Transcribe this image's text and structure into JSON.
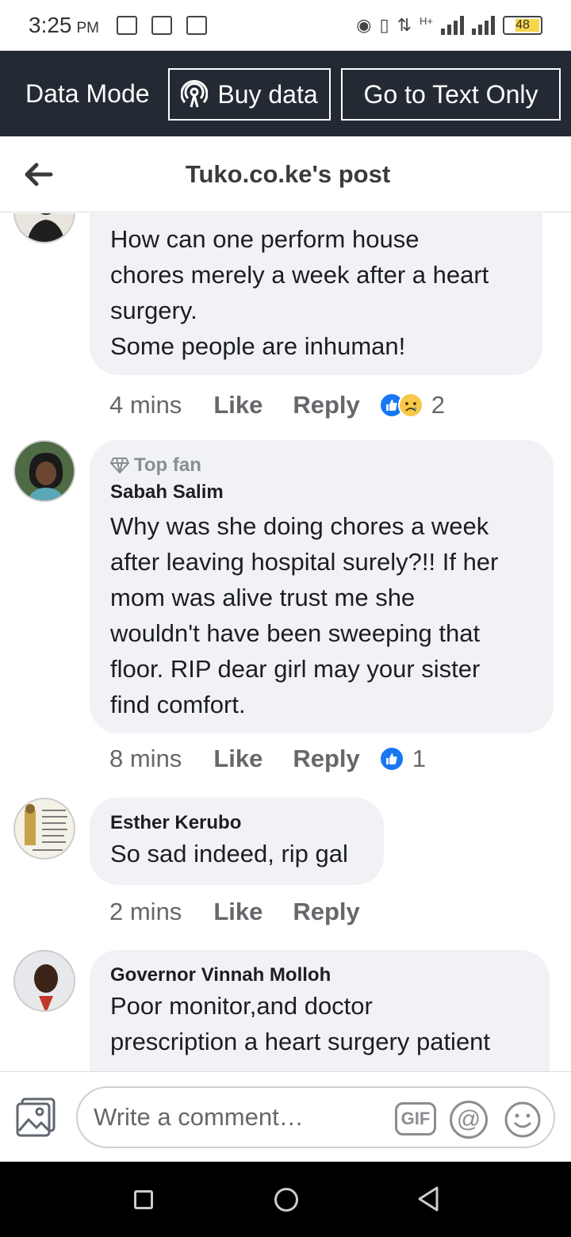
{
  "status_bar": {
    "time": "3:25",
    "ampm": "PM",
    "battery": "48",
    "network": "H+"
  },
  "data_bar": {
    "mode_label": "Data Mode",
    "buy_label": "Buy data",
    "text_only_label": "Go to Text Only"
  },
  "header": {
    "title": "Tuko.co.ke's post"
  },
  "comments": [
    {
      "text": "How can one perform house\nchores merely a week after a heart\nsurgery.\nSome people are inhuman!",
      "time": "4 mins",
      "like": "Like",
      "reply": "Reply",
      "reaction_count": "2"
    },
    {
      "badge": "Top fan",
      "author": "Sabah Salim",
      "text": "Why was she doing chores a week\nafter leaving hospital surely?!! If her\nmom was alive trust me she\nwouldn't have been sweeping that\nfloor. RIP dear girl may your sister\nfind comfort.",
      "time": "8 mins",
      "like": "Like",
      "reply": "Reply",
      "reaction_count": "1"
    },
    {
      "author": "Esther Kerubo",
      "text": "So sad indeed, rip gal",
      "time": "2 mins",
      "like": "Like",
      "reply": "Reply"
    },
    {
      "author": "Governor Vinnah Molloh",
      "text": "Poor monitor,and doctor\nprescription a heart surgery patient"
    }
  ],
  "composer": {
    "placeholder": "Write a comment…",
    "gif_label": "GIF",
    "mention_label": "@"
  },
  "colors": {
    "data_bar_bg": "#232a33",
    "bubble_bg": "#f0f2f5",
    "like_blue": "#1877f2",
    "meta_gray": "#65676b"
  }
}
